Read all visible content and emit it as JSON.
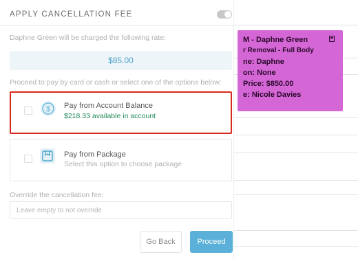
{
  "calendar": {
    "appointment": {
      "title": "M - Daphne Green",
      "service": "r Removal - Full Body",
      "lines": [
        "ne: Daphne",
        "on: None",
        "Price: $850.00",
        "e: Nicole Davies"
      ],
      "color": "#d466d6"
    }
  },
  "dialog": {
    "header_title": "APPLY CANCELLATION FEE",
    "rate_label": "Daphne Green will be charged the following rate:",
    "rate_value": "$85.00",
    "pay_instructions": "Proceed to pay by card or cash or select one of the options below:",
    "options": [
      {
        "title": "Pay from Account Balance",
        "subtitle": "$218.33 available in account",
        "icon": "dollar-circle-icon",
        "highlighted": true
      },
      {
        "title": "Pay from Package",
        "subtitle": "Select this option to choose package",
        "icon": "package-icon",
        "highlighted": false
      }
    ],
    "override_label": "Override the cancellation fee:",
    "override_placeholder": "Leave empty to not override",
    "override_value": "",
    "go_back_label": "Go Back",
    "proceed_label": "Proceed"
  },
  "colors": {
    "accent": "#5ab0d8",
    "rate_text": "#4ba3c7",
    "balance_green": "#1f8a5a",
    "highlight_red": "#d6281b"
  }
}
